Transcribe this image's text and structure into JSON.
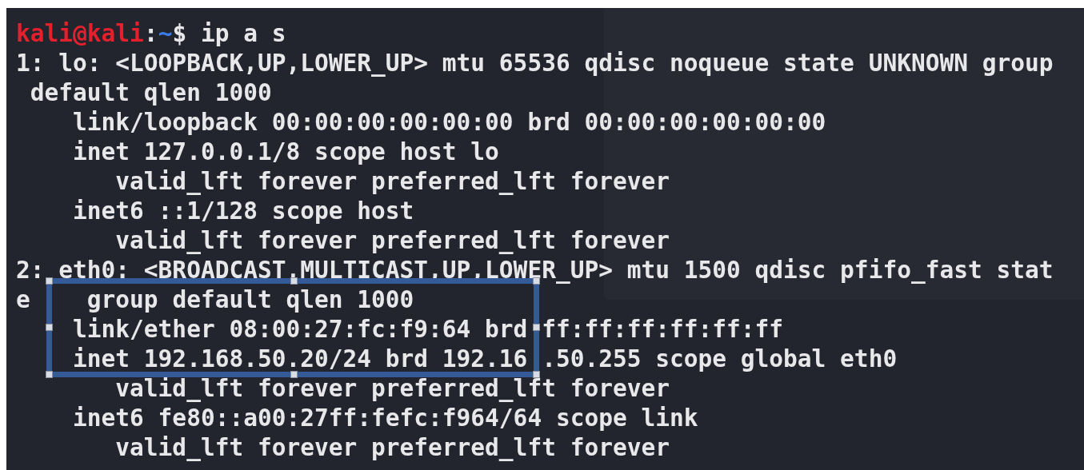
{
  "prompt": {
    "user_host": "kali@kali",
    "separator": ":",
    "path": "~",
    "command": "$ ip a s"
  },
  "output_lines": [
    [
      "1: lo: <LOOPBACK,UP,LOWER_UP> mtu 65536 qdisc noqueue state UNKNOWN group"
    ],
    [
      " default qlen 1000"
    ],
    [
      "    link/loopback 00:00:00:00:00:00 brd 00:00:00:00:00:00"
    ],
    [
      "    inet 127.0.0.1/8 scope host lo"
    ],
    [
      "       valid_lft forever preferred_lft forever"
    ],
    [
      "    inet6 ::1/128 scope host"
    ],
    [
      "       valid_lft forever preferred_lft forever"
    ],
    [
      "2: eth0: <BROADCAST,MULTICAST,UP,LOWER_UP> mtu 1500 qdisc pfifo_fast stat"
    ],
    [
      "e    ",
      "group default qlen 1000"
    ],
    [
      "    link/ether 08:00:27:fc:f9:64 brd ff:ff:ff:ff:ff:ff"
    ],
    [
      "    inet 192.168.50.20/24 brd 192.16 ",
      ".50.255 scope global eth0"
    ],
    [
      "       valid_lft forever preferred_lft forever"
    ],
    [
      "    inet6 fe80::a00:27ff:fefc:f964/64 scope link"
    ],
    [
      "       valid_lft forever preferred_lft forever"
    ]
  ]
}
